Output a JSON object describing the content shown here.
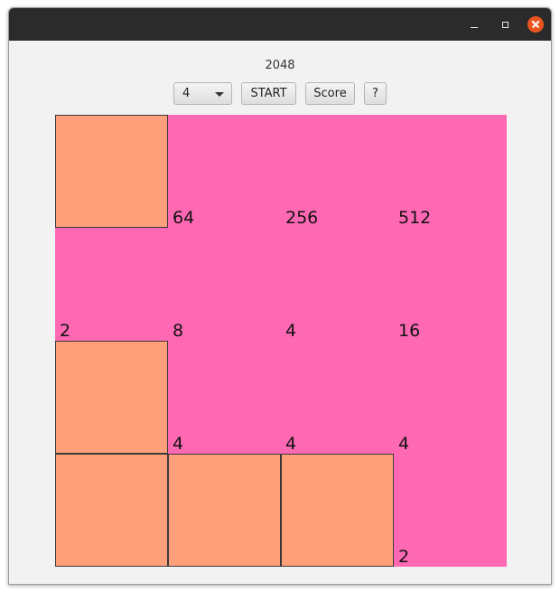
{
  "window": {
    "controls": [
      "minimize-icon",
      "maximize-icon",
      "close-icon"
    ]
  },
  "app": {
    "title": "2048"
  },
  "toolbar": {
    "size_value": "4",
    "start_label": "START",
    "score_label": "Score",
    "help_label": "?"
  },
  "board": {
    "colors": {
      "background": "#ff69b4",
      "empty_tile": "#ffa07a"
    },
    "grid": [
      [
        "",
        "64",
        "256",
        "512"
      ],
      [
        "2",
        "8",
        "4",
        "16"
      ],
      [
        "",
        "4",
        "4",
        "4"
      ],
      [
        "",
        "",
        "",
        "2"
      ]
    ]
  }
}
